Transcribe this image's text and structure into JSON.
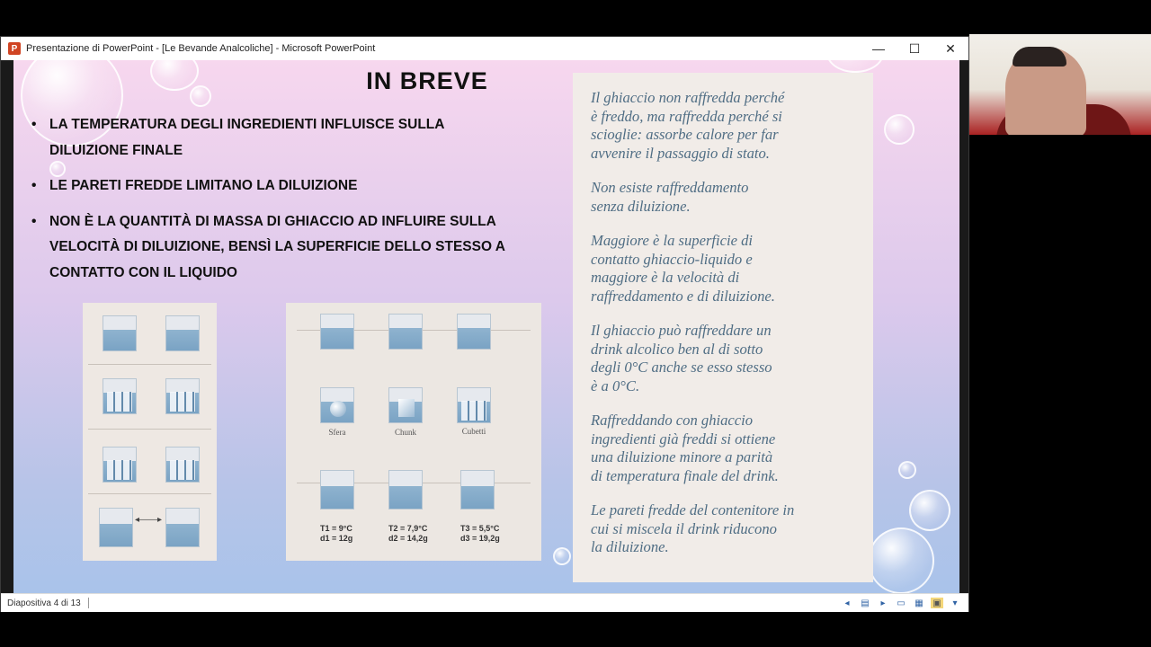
{
  "window": {
    "title": "Presentazione di PowerPoint - [Le Bevande Analcoliche] - Microsoft PowerPoint",
    "app_icon_letter": "P",
    "controls": {
      "minimize": "—",
      "maximize": "☐",
      "close": "✕"
    }
  },
  "slide": {
    "title": "IN BREVE",
    "bullets": [
      "LA TEMPERATURA DEGLI INGREDIENTI INFLUISCE SULLA DILUIZIONE FINALE",
      "LE PARETI FREDDE LIMITANO LA DILUIZIONE",
      "NON È LA QUANTITÀ DI MASSA  DI GHIACCIO AD INFLUIRE SULLA  VELOCITÀ DI DILUIZIONE, BENSÌ LA SUPERFICIE DELLO STESSO  A CONTATTO CON  IL LIQUIDO"
    ],
    "figure_mid": {
      "labels": [
        "Sfera",
        "Chunk",
        "Cubetti"
      ],
      "temps": [
        {
          "t": "T1 = 9°C",
          "d": "d1 = 12g"
        },
        {
          "t": "T2 = 7,9°C",
          "d": "d2 = 14,2g"
        },
        {
          "t": "T3 = 5,5°C",
          "d": "d3 = 19,2g"
        }
      ]
    },
    "figure_left": {
      "arrow": "◂——▸"
    },
    "panel_paragraphs": [
      "Il ghiaccio non raffredda perché\nè freddo, ma raffredda perché si\nscioglie: assorbe calore per far\navvenire il passaggio di stato.",
      "Non esiste raffreddamento\nsenza diluizione.",
      "Maggiore è la superficie di\ncontatto ghiaccio-liquido e\nmaggiore è la velocità di\nraffreddamento e di diluizione.",
      "Il ghiaccio può raffreddare un\ndrink alcolico ben al di sotto\ndegli 0°C anche se esso stesso\nè a 0°C.",
      "Raffreddando con ghiaccio\ningredienti già freddi si ottiene\nuna diluizione minore a parità\ndi temperatura finale del drink.",
      "Le pareti fredde del contenitore in\ncui si miscela il drink riducono\nla diluizione."
    ]
  },
  "statusbar": {
    "slide_counter": "Diapositiva 4 di 13",
    "icons": [
      "prev-slide-icon",
      "notes-icon",
      "next-slide-icon",
      "normal-view-icon",
      "sorter-view-icon",
      "reading-view-icon",
      "slideshow-icon"
    ]
  },
  "colors": {
    "slide_gradient_top": "#f7d7ee",
    "slide_gradient_bottom": "#a9c3ea",
    "panel_text": "#4f6d84",
    "app_icon": "#d04423"
  }
}
